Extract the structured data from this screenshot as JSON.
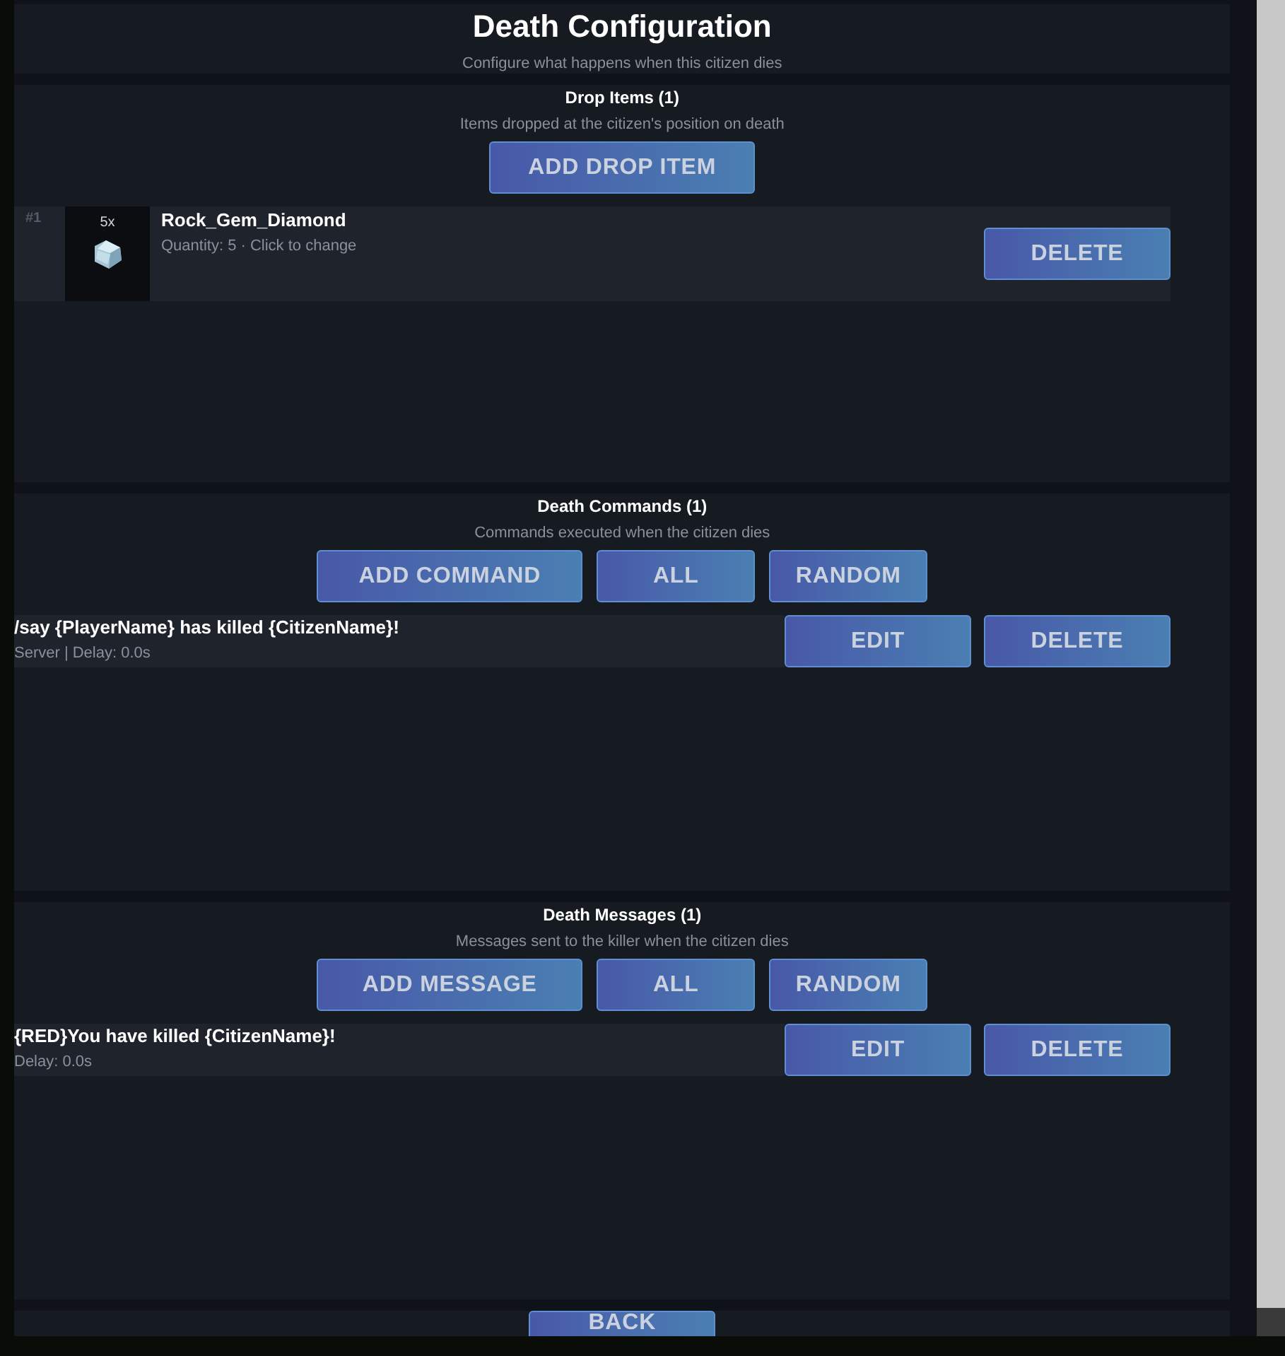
{
  "header": {
    "title": "Death Configuration",
    "subtitle": "Configure what happens when this citizen dies"
  },
  "sections": [
    {
      "title": "Drop Items (1)",
      "description": "Items dropped at the citizen's position on death",
      "buttons": [
        "ADD DROP ITEM"
      ],
      "entries": [
        {
          "kind": "item",
          "index": "#1",
          "count": "5x",
          "name": "Rock_Gem_Diamond",
          "detail": "Quantity: 5 · Click to change",
          "buttons": [
            "DELETE"
          ]
        }
      ]
    },
    {
      "title": "Death Commands (1)",
      "description": "Commands executed when the citizen dies",
      "buttons": [
        "ADD COMMAND",
        "ALL",
        "RANDOM"
      ],
      "entries": [
        {
          "kind": "text",
          "name": "/say {PlayerName} has killed {CitizenName}!",
          "detail": "Server | Delay: 0.0s",
          "buttons": [
            "EDIT",
            "DELETE"
          ]
        }
      ]
    },
    {
      "title": "Death Messages (1)",
      "description": "Messages sent to the killer when the citizen dies",
      "buttons": [
        "ADD MESSAGE",
        "ALL",
        "RANDOM"
      ],
      "entries": [
        {
          "kind": "text",
          "name": "{RED}You have killed {CitizenName}!",
          "detail": "Delay: 0.0s",
          "buttons": [
            "EDIT",
            "DELETE"
          ]
        }
      ]
    }
  ],
  "footer": {
    "button": "BACK"
  }
}
